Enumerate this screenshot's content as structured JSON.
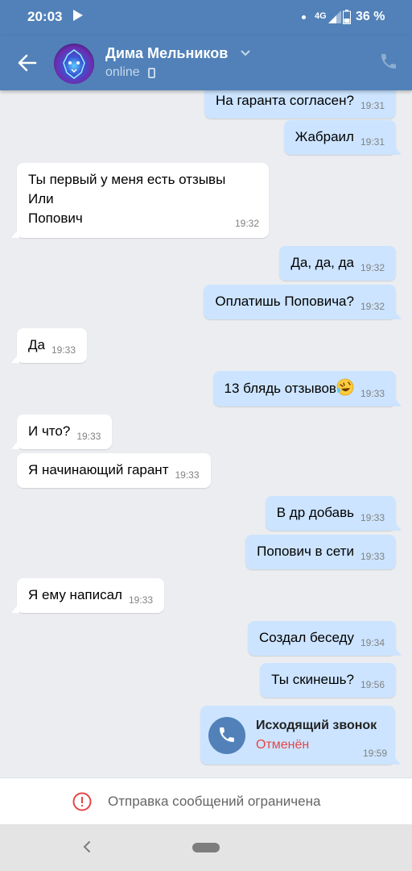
{
  "status_bar": {
    "time": "20:03",
    "network": "4G",
    "battery": "36 %"
  },
  "header": {
    "contact_name": "Дима Мельников",
    "status": "online"
  },
  "messages": [
    {
      "dir": "out",
      "text": "На гаранта согласен?",
      "time": "19:31"
    },
    {
      "dir": "out",
      "text": "Жабраил",
      "time": "19:31"
    },
    {
      "dir": "in",
      "text": "Ты первый у меня есть отзывы\nИли\nПопович",
      "time": "19:32"
    },
    {
      "dir": "out",
      "text": "Да, да, да",
      "time": "19:32"
    },
    {
      "dir": "out",
      "text": "Оплатишь Поповича?",
      "time": "19:32"
    },
    {
      "dir": "in",
      "text": "Да",
      "time": "19:33"
    },
    {
      "dir": "out",
      "text": "13 блядь отзывов",
      "time": "19:33",
      "emoji": "rofl"
    },
    {
      "dir": "in",
      "text": "И что?",
      "time": "19:33"
    },
    {
      "dir": "in",
      "text": "Я начинающий гарант",
      "time": "19:33"
    },
    {
      "dir": "out",
      "text": "В др добавь",
      "time": "19:33"
    },
    {
      "dir": "out",
      "text": "Попович в сети",
      "time": "19:33"
    },
    {
      "dir": "in",
      "text": "Я ему написал",
      "time": "19:33"
    },
    {
      "dir": "out",
      "text": "Создал беседу",
      "time": "19:34"
    },
    {
      "dir": "out",
      "text": "Ты скинешь?",
      "time": "19:56"
    }
  ],
  "call": {
    "title": "Исходящий звонок",
    "status": "Отменён",
    "time": "19:59"
  },
  "restriction": {
    "text": "Отправка сообщений ограничена"
  },
  "colors": {
    "header": "#5181b8",
    "outgoing_bubble": "#cce4ff",
    "incoming_bubble": "#ffffff",
    "chat_background": "#ebedf0",
    "cancelled": "#e64646"
  }
}
